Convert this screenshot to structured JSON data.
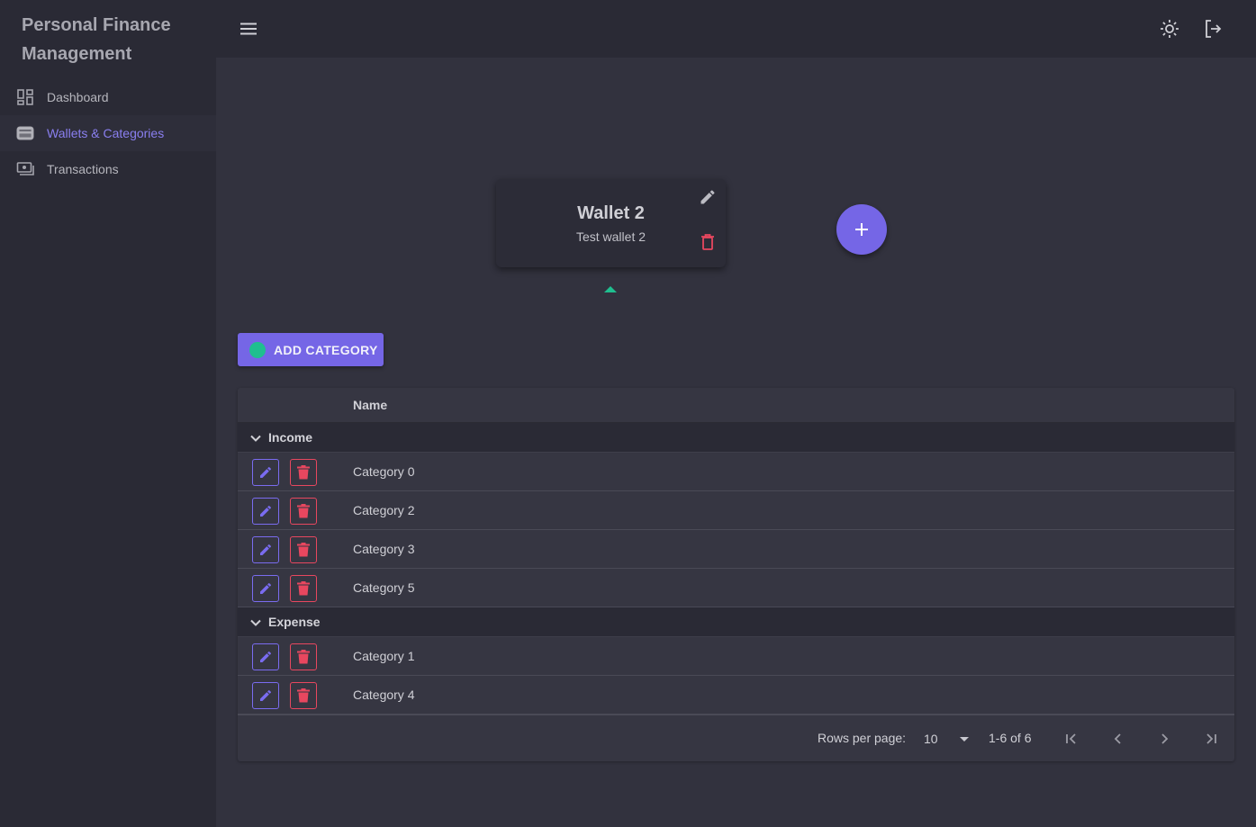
{
  "app": {
    "title": "Personal Finance Management"
  },
  "sidebar": {
    "items": [
      {
        "label": "Dashboard",
        "icon": "dashboard-icon",
        "active": false
      },
      {
        "label": "Wallets & Categories",
        "icon": "wallet-icon",
        "active": true
      },
      {
        "label": "Transactions",
        "icon": "money-icon",
        "active": false
      }
    ]
  },
  "topbar": {
    "icons": [
      "menu-icon",
      "theme-sun-icon",
      "logout-icon"
    ]
  },
  "wallet": {
    "name": "Wallet 2",
    "description": "Test wallet 2"
  },
  "actions": {
    "add_category_label": "ADD CATEGORY"
  },
  "table": {
    "column_name": "Name",
    "groups": [
      {
        "label": "Income",
        "rows": [
          "Category 0",
          "Category 2",
          "Category 3",
          "Category 5"
        ]
      },
      {
        "label": "Expense",
        "rows": [
          "Category 1",
          "Category 4"
        ]
      }
    ],
    "pagination": {
      "rows_per_page_label": "Rows per page:",
      "rows_per_page": "10",
      "range": "1-6 of 6"
    }
  },
  "colors": {
    "accent": "#7566e6",
    "danger": "#e8475f",
    "success": "#1fbf8f",
    "background": "#32323e",
    "sidebar": "#2a2a35"
  }
}
